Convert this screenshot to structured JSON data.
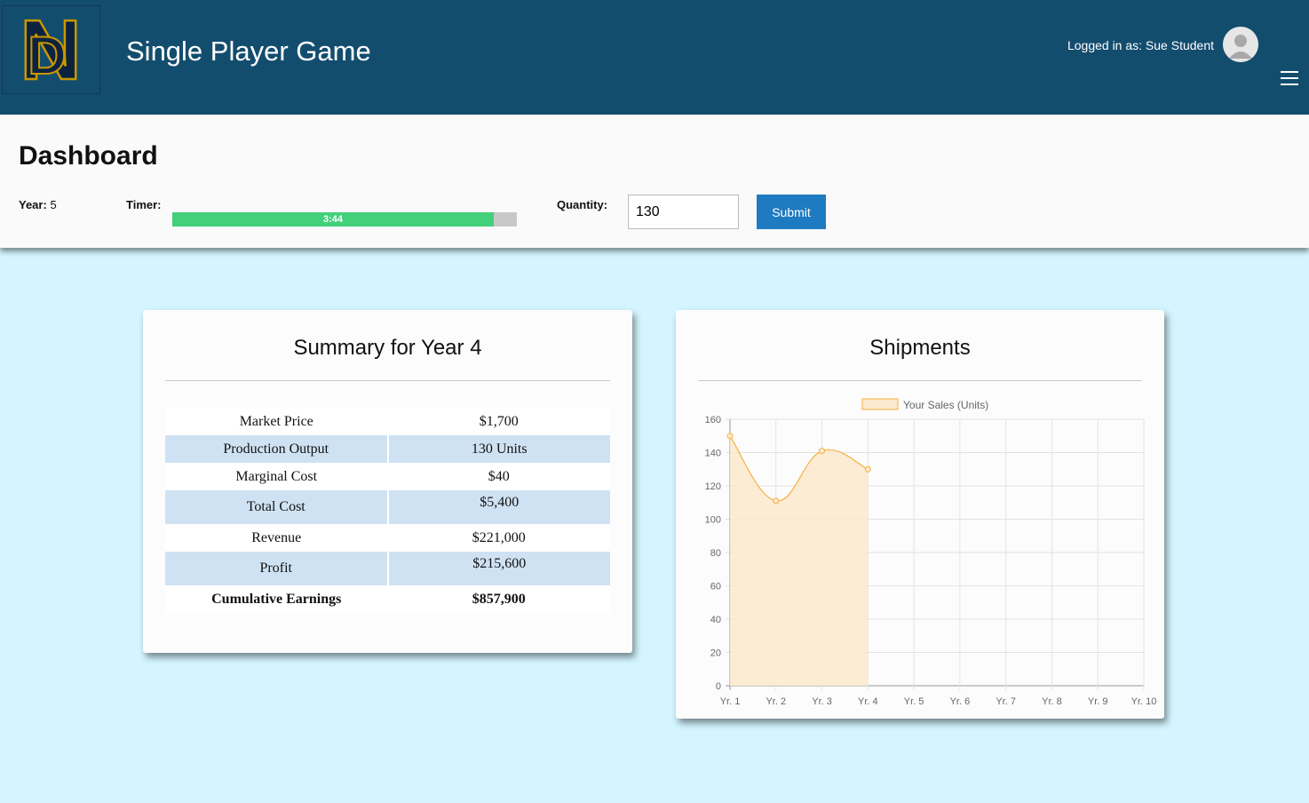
{
  "header": {
    "app_title": "Single Player Game",
    "logged_in_label": "Logged in as: Sue Student"
  },
  "dashboard": {
    "title": "Dashboard",
    "year_label": "Year:",
    "year_value": "5",
    "timer_label": "Timer:",
    "timer_text": "3:44",
    "timer_progress": 0.933,
    "quantity_label": "Quantity:",
    "quantity_value": "130",
    "submit_label": "Submit"
  },
  "summary": {
    "title": "Summary for Year 4",
    "rows": [
      {
        "label": "Market Price",
        "value": "$1,700"
      },
      {
        "label": "Production Output",
        "value": "130 Units"
      },
      {
        "label": "Marginal Cost",
        "value": "$40"
      },
      {
        "label": "Total Cost",
        "value": "$5,400"
      },
      {
        "label": "Revenue",
        "value": "$221,000"
      },
      {
        "label": "Profit",
        "value": "$215,600"
      },
      {
        "label": "Cumulative Earnings",
        "value": "$857,900"
      }
    ]
  },
  "shipments": {
    "title": "Shipments"
  },
  "chart_data": {
    "type": "area",
    "categories": [
      "Yr. 1",
      "Yr. 2",
      "Yr. 3",
      "Yr. 4",
      "Yr. 5",
      "Yr. 6",
      "Yr. 7",
      "Yr. 8",
      "Yr. 9",
      "Yr. 10"
    ],
    "series": [
      {
        "name": "Your Sales (Units)",
        "values": [
          150,
          111,
          141,
          130,
          null,
          null,
          null,
          null,
          null,
          null
        ]
      }
    ],
    "ylim": [
      0,
      160
    ],
    "yticks": [
      0,
      20,
      40,
      60,
      80,
      100,
      120,
      140,
      160
    ],
    "grid": true,
    "legend": "top",
    "colors": {
      "line": "#f5b041",
      "fill": "#fbe9cd"
    }
  },
  "colors": {
    "header_bg": "#134d6e",
    "page_bg": "#d4f5ff",
    "accent": "#1f7bc1",
    "timer_fill": "#43d07a",
    "row_stripe": "#cfe2f3"
  }
}
